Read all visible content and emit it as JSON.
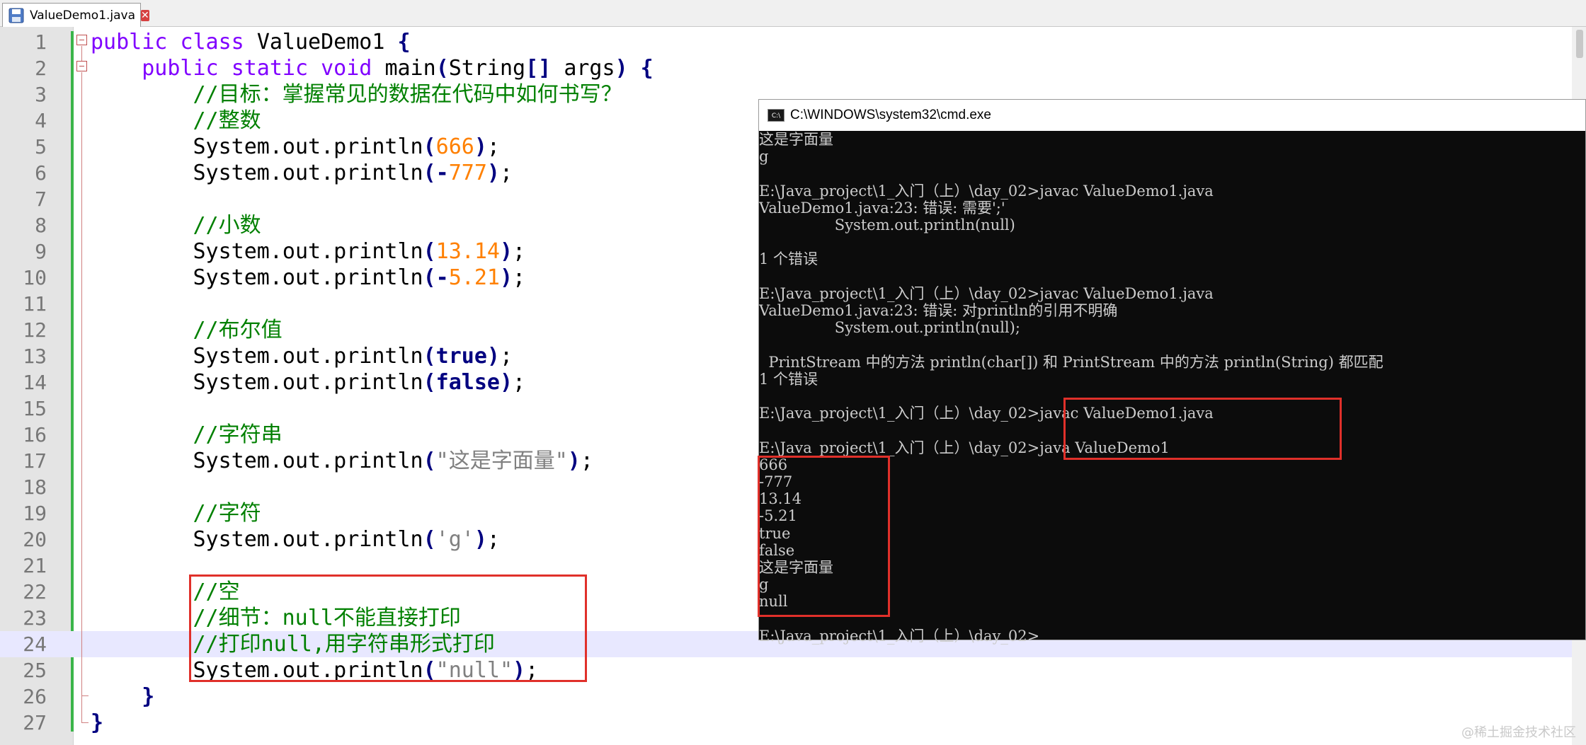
{
  "tab": {
    "filename": "ValueDemo1.java",
    "close_glyph": "✕"
  },
  "editor": {
    "current_line": 24,
    "lines": [
      {
        "n": "1",
        "segs": [
          [
            "kw",
            "public "
          ],
          [
            "kw",
            "class "
          ],
          [
            "t",
            "ValueDemo1 "
          ],
          [
            "br",
            "{"
          ]
        ]
      },
      {
        "n": "2",
        "segs": [
          [
            "t",
            "    "
          ],
          [
            "kw",
            "public "
          ],
          [
            "kw",
            "static "
          ],
          [
            "kw",
            "void "
          ],
          [
            "t",
            "main"
          ],
          [
            "br",
            "("
          ],
          [
            "t",
            "String"
          ],
          [
            "br",
            "[] "
          ],
          [
            "t",
            "args"
          ],
          [
            "br",
            ") {"
          ]
        ]
      },
      {
        "n": "3",
        "segs": [
          [
            "t",
            "        "
          ],
          [
            "cmt",
            "//目标：掌握常见的数据在代码中如何书写？"
          ]
        ]
      },
      {
        "n": "4",
        "segs": [
          [
            "t",
            "        "
          ],
          [
            "cmt",
            "//整数"
          ]
        ]
      },
      {
        "n": "5",
        "segs": [
          [
            "t",
            "        System.out.println"
          ],
          [
            "br",
            "("
          ],
          [
            "num",
            "666"
          ],
          [
            "br",
            ")"
          ],
          [
            "t",
            ";"
          ]
        ]
      },
      {
        "n": "6",
        "segs": [
          [
            "t",
            "        System.out.println"
          ],
          [
            "br",
            "("
          ],
          [
            "op",
            "-"
          ],
          [
            "num",
            "777"
          ],
          [
            "br",
            ")"
          ],
          [
            "t",
            ";"
          ]
        ]
      },
      {
        "n": "7",
        "segs": []
      },
      {
        "n": "8",
        "segs": [
          [
            "t",
            "        "
          ],
          [
            "cmt",
            "//小数"
          ]
        ]
      },
      {
        "n": "9",
        "segs": [
          [
            "t",
            "        System.out.println"
          ],
          [
            "br",
            "("
          ],
          [
            "num",
            "13.14"
          ],
          [
            "br",
            ")"
          ],
          [
            "t",
            ";"
          ]
        ]
      },
      {
        "n": "10",
        "segs": [
          [
            "t",
            "        System.out.println"
          ],
          [
            "br",
            "("
          ],
          [
            "op",
            "-"
          ],
          [
            "num",
            "5.21"
          ],
          [
            "br",
            ")"
          ],
          [
            "t",
            ";"
          ]
        ]
      },
      {
        "n": "11",
        "segs": []
      },
      {
        "n": "12",
        "segs": [
          [
            "t",
            "        "
          ],
          [
            "cmt",
            "//布尔值"
          ]
        ]
      },
      {
        "n": "13",
        "segs": [
          [
            "t",
            "        System.out.println"
          ],
          [
            "br",
            "("
          ],
          [
            "lit",
            "true"
          ],
          [
            "br",
            ")"
          ],
          [
            "t",
            ";"
          ]
        ]
      },
      {
        "n": "14",
        "segs": [
          [
            "t",
            "        System.out.println"
          ],
          [
            "br",
            "("
          ],
          [
            "lit",
            "false"
          ],
          [
            "br",
            ")"
          ],
          [
            "t",
            ";"
          ]
        ]
      },
      {
        "n": "15",
        "segs": []
      },
      {
        "n": "16",
        "segs": [
          [
            "t",
            "        "
          ],
          [
            "cmt",
            "//字符串"
          ]
        ]
      },
      {
        "n": "17",
        "segs": [
          [
            "t",
            "        System.out.println"
          ],
          [
            "br",
            "("
          ],
          [
            "str",
            "\"这是字面量\""
          ],
          [
            "br",
            ")"
          ],
          [
            "t",
            ";"
          ]
        ]
      },
      {
        "n": "18",
        "segs": []
      },
      {
        "n": "19",
        "segs": [
          [
            "t",
            "        "
          ],
          [
            "cmt",
            "//字符"
          ]
        ]
      },
      {
        "n": "20",
        "segs": [
          [
            "t",
            "        System.out.println"
          ],
          [
            "br",
            "("
          ],
          [
            "str",
            "'g'"
          ],
          [
            "br",
            ")"
          ],
          [
            "t",
            ";"
          ]
        ]
      },
      {
        "n": "21",
        "segs": []
      },
      {
        "n": "22",
        "segs": [
          [
            "t",
            "        "
          ],
          [
            "cmt",
            "//空"
          ]
        ]
      },
      {
        "n": "23",
        "segs": [
          [
            "t",
            "        "
          ],
          [
            "cmt",
            "//细节：null不能直接打印"
          ]
        ]
      },
      {
        "n": "24",
        "segs": [
          [
            "t",
            "        "
          ],
          [
            "cmt",
            "//打印null,用字符串形式打印"
          ]
        ]
      },
      {
        "n": "25",
        "segs": [
          [
            "t",
            "        System.out.println"
          ],
          [
            "br",
            "("
          ],
          [
            "str",
            "\"null\""
          ],
          [
            "br",
            ")"
          ],
          [
            "t",
            ";"
          ]
        ]
      },
      {
        "n": "26",
        "segs": [
          [
            "t",
            "    "
          ],
          [
            "br",
            "}"
          ]
        ]
      },
      {
        "n": "27",
        "segs": [
          [
            "br",
            "}"
          ]
        ]
      }
    ]
  },
  "cmd": {
    "icon_label": "C:\\",
    "title": "C:\\WINDOWS\\system32\\cmd.exe",
    "lines": [
      "这是字面量",
      "g",
      "",
      "E:\\Java_project\\1_入门（上）\\day_02>javac ValueDemo1.java",
      "ValueDemo1.java:23: 错误: 需要';'",
      "                System.out.println(null)",
      "",
      "1 个错误",
      "",
      "E:\\Java_project\\1_入门（上）\\day_02>javac ValueDemo1.java",
      "ValueDemo1.java:23: 错误: 对println的引用不明确",
      "                System.out.println(null);",
      "",
      "  PrintStream 中的方法 println(char[]) 和 PrintStream 中的方法 println(String) 都匹配",
      "1 个错误",
      "",
      "E:\\Java_project\\1_入门（上）\\day_02>javac ValueDemo1.java",
      "",
      "E:\\Java_project\\1_入门（上）\\day_02>java ValueDemo1",
      "666",
      "-777",
      "13.14",
      "-5.21",
      "true",
      "false",
      "这是字面量",
      "g",
      "null",
      "",
      "E:\\Java_project\\1_入门（上）\\day_02>"
    ]
  },
  "watermark": "@稀土掘金技术社区",
  "colors": {
    "highlight_box": "#e0302a",
    "current_line": "#e8e8ff",
    "comment": "#008000",
    "keyword": "#8000ff",
    "number": "#ff8000"
  },
  "icons": {
    "tab_icon": "save-disk-icon",
    "cmd_icon": "cmd-prompt-icon"
  }
}
